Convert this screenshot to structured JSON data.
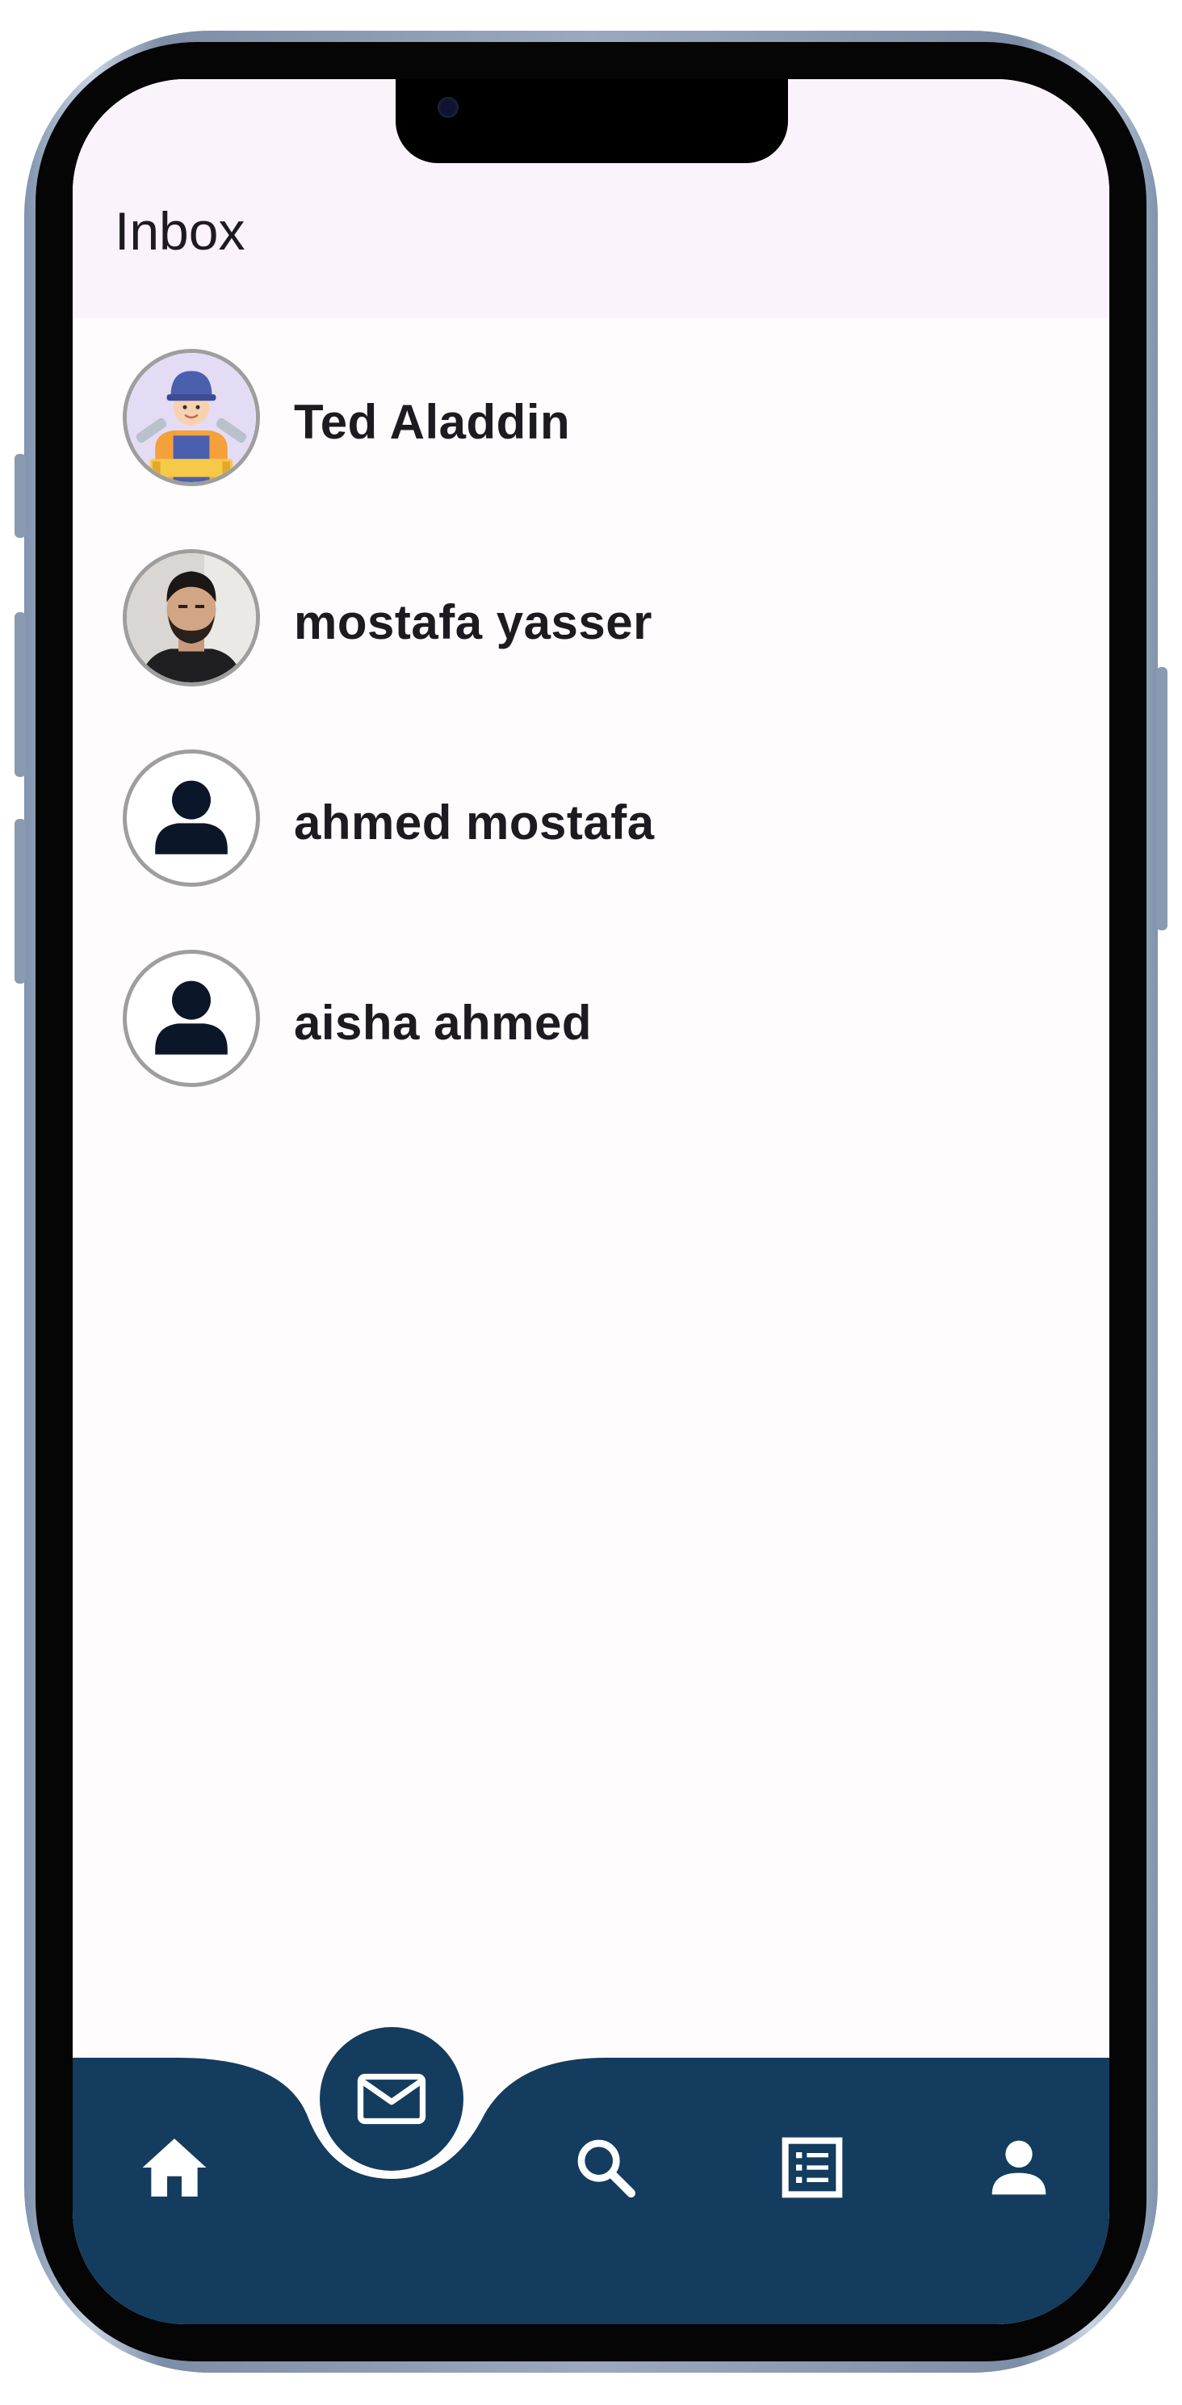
{
  "app_bar": {
    "title": "Inbox"
  },
  "chats": [
    {
      "name": "Ted Aladdin",
      "avatar": "plumber-illustration"
    },
    {
      "name": "mostafa yasser",
      "avatar": "profile-photo"
    },
    {
      "name": "ahmed mostafa",
      "avatar": "person-placeholder-icon"
    },
    {
      "name": "aisha ahmed",
      "avatar": "person-placeholder-icon"
    }
  ],
  "nav": {
    "items": [
      "home-icon",
      "mail-icon",
      "search-icon",
      "list-icon",
      "person-icon"
    ],
    "active": "mail-icon"
  },
  "colors": {
    "nav_background": "#133c5e",
    "app_bar_background": "#fbf3fb",
    "screen_background": "#fffcfd",
    "text": "#1d1b20"
  }
}
